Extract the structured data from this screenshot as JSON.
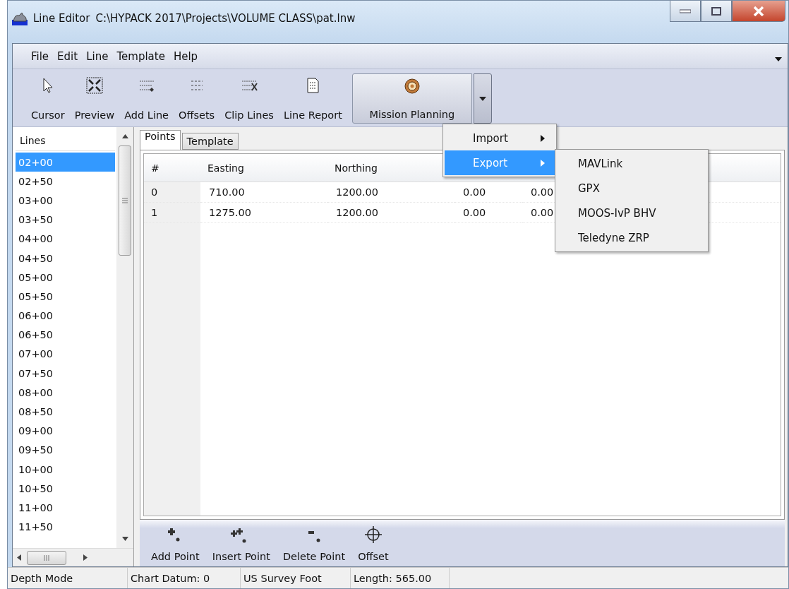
{
  "window": {
    "title": "Line Editor",
    "path": "C:\\HYPACK 2017\\Projects\\VOLUME CLASS\\pat.lnw"
  },
  "menu_bar": [
    "File",
    "Edit",
    "Line",
    "Template",
    "Help"
  ],
  "toolbar": [
    {
      "label": "Cursor",
      "kind": "cursor"
    },
    {
      "label": "Preview",
      "kind": "preview"
    },
    {
      "label": "Add Line",
      "kind": "addline"
    },
    {
      "label": "Offsets",
      "kind": "offsets"
    },
    {
      "label": "Clip Lines",
      "kind": "clip"
    },
    {
      "label": "Line Report",
      "kind": "report"
    },
    {
      "label": "Mission Planning",
      "kind": "mission"
    }
  ],
  "mission_menu": [
    {
      "label": "Import",
      "selected": false
    },
    {
      "label": "Export",
      "selected": true
    }
  ],
  "export_submenu": [
    "MAVLink",
    "GPX",
    "MOOS-IvP BHV",
    "Teledyne ZRP"
  ],
  "lines": {
    "header": "Lines",
    "items": [
      {
        "label": "02+00",
        "selected": true
      },
      {
        "label": "02+50",
        "selected": false
      },
      {
        "label": "03+00",
        "selected": false
      },
      {
        "label": "03+50",
        "selected": false
      },
      {
        "label": "04+00",
        "selected": false
      },
      {
        "label": "04+50",
        "selected": false
      },
      {
        "label": "05+00",
        "selected": false
      },
      {
        "label": "05+50",
        "selected": false
      },
      {
        "label": "06+00",
        "selected": false
      },
      {
        "label": "06+50",
        "selected": false
      },
      {
        "label": "07+00",
        "selected": false
      },
      {
        "label": "07+50",
        "selected": false
      },
      {
        "label": "08+00",
        "selected": false
      },
      {
        "label": "08+50",
        "selected": false
      },
      {
        "label": "09+00",
        "selected": false
      },
      {
        "label": "09+50",
        "selected": false
      },
      {
        "label": "10+00",
        "selected": false
      },
      {
        "label": "10+50",
        "selected": false
      },
      {
        "label": "11+00",
        "selected": false
      },
      {
        "label": "11+50",
        "selected": false
      }
    ]
  },
  "tabs": [
    {
      "label": "Points",
      "selected": true
    },
    {
      "label": "Template",
      "selected": false
    }
  ],
  "table": {
    "columns": [
      "#",
      "Easting",
      "Northing"
    ],
    "rows": [
      [
        "0",
        "710.00",
        "1200.00",
        "0.00",
        "0.00"
      ],
      [
        "1",
        "1275.00",
        "1200.00",
        "0.00",
        "0.00"
      ]
    ]
  },
  "point_toolbar": [
    {
      "label": "Add Point",
      "kind": "add"
    },
    {
      "label": "Insert Point",
      "kind": "insert"
    },
    {
      "label": "Delete Point",
      "kind": "delete"
    },
    {
      "label": "Offset",
      "kind": "offset"
    }
  ],
  "status_bar": [
    "Depth Mode",
    "Chart Datum: 0",
    "US Survey Foot",
    "Length: 565.00"
  ]
}
